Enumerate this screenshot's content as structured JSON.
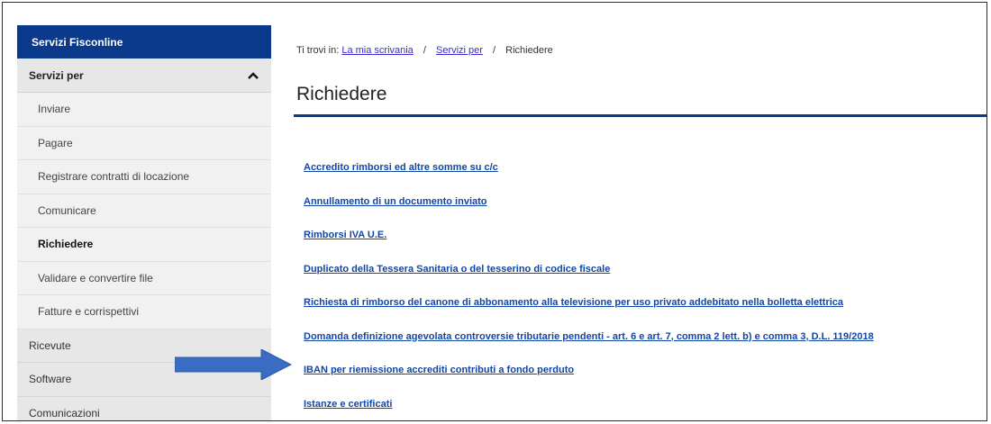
{
  "sidebar": {
    "header": "Servizi Fisconline",
    "group": {
      "label": "Servizi per",
      "icon": "chevron-up-icon"
    },
    "subitems": [
      {
        "label": "Inviare",
        "active": false
      },
      {
        "label": "Pagare",
        "active": false
      },
      {
        "label": "Registrare contratti di locazione",
        "active": false
      },
      {
        "label": "Comunicare",
        "active": false
      },
      {
        "label": "Richiedere",
        "active": true
      },
      {
        "label": "Validare e convertire file",
        "active": false
      },
      {
        "label": "Fatture e corrispettivi",
        "active": false
      }
    ],
    "top_items": [
      {
        "label": "Ricevute"
      },
      {
        "label": "Software"
      },
      {
        "label": "Comunicazioni"
      }
    ]
  },
  "breadcrumb": {
    "prefix": "Ti trovi in:",
    "items": [
      "La mia scrivania",
      "Servizi per"
    ],
    "separator": "/",
    "current": "Richiedere"
  },
  "page": {
    "title": "Richiedere"
  },
  "links": [
    "Accredito rimborsi ed altre somme su c/c",
    "Annullamento di un documento inviato",
    "Rimborsi IVA U.E.",
    "Duplicato della Tessera Sanitaria o del tesserino di codice fiscale",
    "Richiesta di rimborso del canone di abbonamento alla televisione per uso privato addebitato nella bolletta elettrica",
    "Domanda definizione agevolata controversie tributarie pendenti - art. 6 e art. 7, comma 2 lett. b) e comma 3, D.L. 119/2018",
    "IBAN per riemissione accrediti contributi a fondo perduto",
    "Istanze e certificati"
  ],
  "colors": {
    "accent": "#0b3a8c",
    "link": "#1246a6",
    "arrow": "#3a6cc4"
  },
  "annotation": {
    "icon": "arrow-right-icon"
  }
}
